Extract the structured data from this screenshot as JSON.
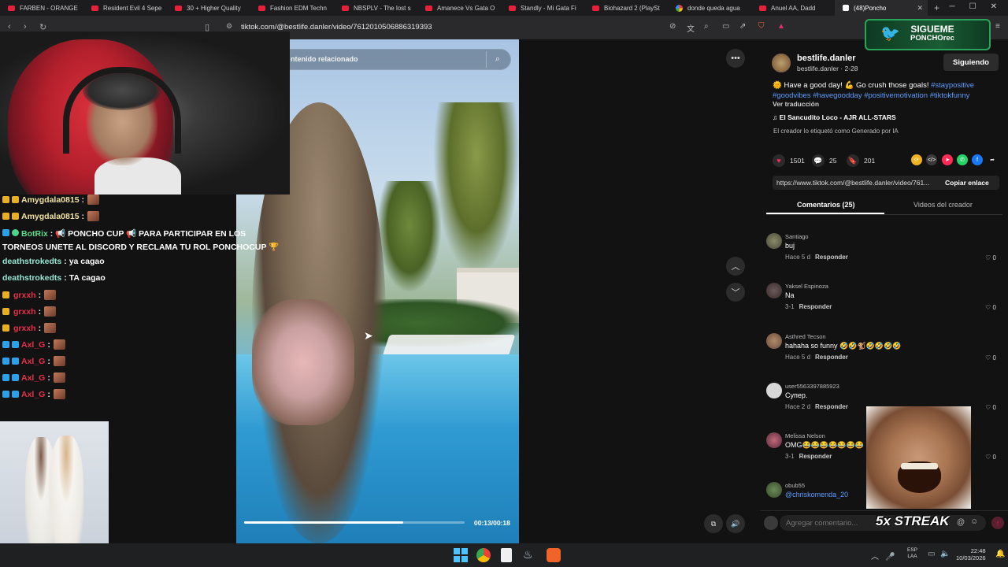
{
  "browser": {
    "tabs": [
      {
        "title": "FARBEN - ORANGE",
        "icon": "youtube"
      },
      {
        "title": "Resident Evil 4 Sepe",
        "icon": "youtube"
      },
      {
        "title": "30 + Higher Quality",
        "icon": "youtube"
      },
      {
        "title": "Fashion EDM Techn",
        "icon": "youtube"
      },
      {
        "title": "NBSPLV - The lost s",
        "icon": "youtube"
      },
      {
        "title": "Amanece Vs Gata O",
        "icon": "youtube"
      },
      {
        "title": "Standly - Mi Gata Fi",
        "icon": "youtube"
      },
      {
        "title": "Biohazard 2 (PlaySt",
        "icon": "youtube"
      },
      {
        "title": "donde queda agua",
        "icon": "google"
      },
      {
        "title": "Anuel AA, Dadd",
        "icon": "youtube"
      },
      {
        "title": "(48)Poncho",
        "icon": "tiktok",
        "active": true
      }
    ],
    "new_tab": "+",
    "url": "tiktok.com/@bestlife.danler/video/7612010506886319393"
  },
  "video": {
    "search_placeholder": "ntenido relacionado",
    "time": "00:13/00:18",
    "progress": 0.72
  },
  "chat": {
    "messages": [
      {
        "user": "Amygdala0815",
        "text": ":",
        "emote": true
      },
      {
        "user": "Amygdala0815",
        "text": ":",
        "emote": true
      },
      {
        "user": "BotRix",
        "text": ": 📢 PONCHO CUP 📢 PARA PARTICIPAR EN LOS TORNEOS UNETE AL DISCORD Y RECLAMA TU ROL PONCHOCUP 🏆"
      },
      {
        "user": "deathstrokedts",
        "text": ": ya cagao"
      },
      {
        "user": "deathstrokedts",
        "text": ": TA cagao"
      },
      {
        "user": "grxxh",
        "text": ":",
        "emote": true
      },
      {
        "user": "grxxh",
        "text": ":",
        "emote": true
      },
      {
        "user": "grxxh",
        "text": ":",
        "emote": true
      },
      {
        "user": "Axl_G",
        "text": ":",
        "emote": true
      },
      {
        "user": "Axl_G",
        "text": ":",
        "emote": true
      },
      {
        "user": "Axl_G",
        "text": ":",
        "emote": true
      },
      {
        "user": "Axl_G",
        "text": ":",
        "emote": true
      }
    ]
  },
  "post": {
    "author": "bestlife.danler",
    "author_sub": "bestlife.danler · 2-28",
    "follow_label": "Siguiendo",
    "description": "🌞 Have a good day! 💪 Go crush those goals!",
    "hashtags": "#staypositive #goodvibes #havegoodday #positivemotivation #tiktokfunny",
    "hashtag_first": "#staypositive",
    "hashtag_rest": "#goodvibes #havegoodday #positivemotivation #tiktokfunny",
    "translate": "Ver traducción",
    "music": "♫  El Sancudito Loco - AJR ALL-STARS",
    "ai_label": "El creador lo etiquetó como Generado por IA",
    "likes": "1501",
    "comments": "25",
    "saves": "201",
    "link": "https://www.tiktok.com/@bestlife.danler/video/761...",
    "copy_link": "Copiar enlace",
    "tab_comments": "Comentarios (25)",
    "tab_videos": "Videos del creador"
  },
  "comments": [
    {
      "user": "Santiago",
      "body": "buj",
      "time": "Hace 5 d",
      "reply": "Responder",
      "likes": "0"
    },
    {
      "user": "Yaksel Espinoza",
      "body": "Na",
      "time": "3-1",
      "reply": "Responder",
      "likes": "0"
    },
    {
      "user": "Asthred Tecson",
      "body": "hahaha so funny 🤣🤣🐒🤣🤣🤣🤣",
      "time": "Hace 5 d",
      "reply": "Responder",
      "likes": "0"
    },
    {
      "user": "user5563397885923",
      "body": "Супер.",
      "time": "Hace 2 d",
      "reply": "Responder",
      "likes": "0"
    },
    {
      "user": "Melissa Nelson",
      "body": "OMG😂😂😂😂😂😂😂",
      "time": "3-1",
      "reply": "Responder",
      "likes": "0"
    },
    {
      "user": "obub55",
      "body": "@chriskomenda_20",
      "time": "",
      "reply": "",
      "likes": ""
    }
  ],
  "comment_input": {
    "placeholder": "Agregar comentario...",
    "streak": "5x STREAK"
  },
  "overlay": {
    "twitter_line1": "SIGUEME",
    "twitter_line2": "PONCHOrec"
  },
  "taskbar": {
    "lang_line1": "ESP",
    "lang_line2": "LAA",
    "time": "22:48",
    "date": "10/03/2026"
  }
}
